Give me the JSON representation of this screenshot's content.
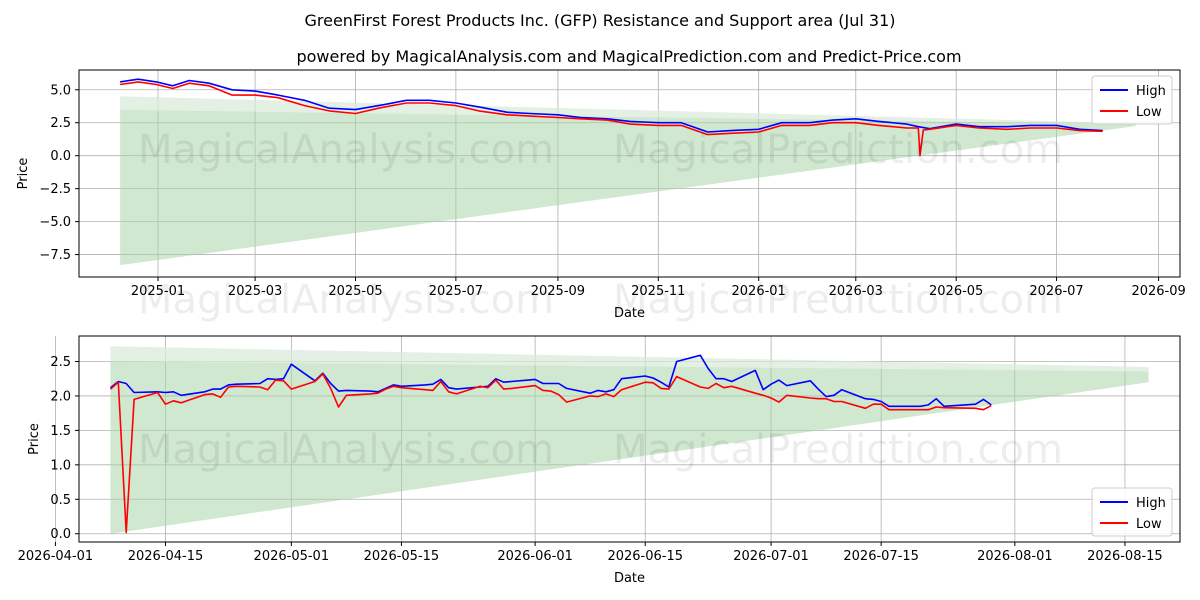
{
  "title": "GreenFirst Forest Products Inc. (GFP) Resistance and Support area (Jul 31)",
  "subtitle": "powered by MagicalAnalysis.com and MagicalPrediction.com and Predict-Price.com",
  "watermark_left": "MagicalAnalysis.com",
  "watermark_right": "MagicalPrediction.com",
  "colors": {
    "high": "#0000ff",
    "low": "#ff0000",
    "band": "#a9d4a9"
  },
  "chart_data": [
    {
      "type": "line",
      "xlabel": "Date",
      "ylabel": "Price",
      "x_ticks": [
        "2025-01",
        "2025-03",
        "2025-05",
        "2025-07",
        "2025-09",
        "2025-11",
        "2026-01",
        "2026-03",
        "2026-05",
        "2026-07",
        "2026-09"
      ],
      "y_ticks": [
        "−7.5",
        "−5.0",
        "−2.5",
        "0.0",
        "2.5",
        "5.0"
      ],
      "legend": {
        "position": "top-right",
        "entries": [
          "High",
          "Low"
        ]
      },
      "grid": true,
      "xlim": [
        "2024-11-14",
        "2026-09-14"
      ],
      "ylim": [
        -9.2,
        6.5
      ],
      "band": {
        "x": [
          "2024-12-09",
          "2026-08-18"
        ],
        "upper_start": 4.5,
        "lower_start": -8.3,
        "upper_end": 2.45,
        "lower_end": 2.25
      },
      "series": [
        {
          "name": "High",
          "x": [
            "2024-12-09",
            "2024-12-20",
            "2024-12-31",
            "2025-01-10",
            "2025-01-20",
            "2025-02-01",
            "2025-02-15",
            "2025-03-01",
            "2025-03-15",
            "2025-03-31",
            "2025-04-15",
            "2025-05-01",
            "2025-05-15",
            "2025-06-01",
            "2025-06-15",
            "2025-07-01",
            "2025-07-15",
            "2025-08-01",
            "2025-08-15",
            "2025-09-01",
            "2025-09-15",
            "2025-10-01",
            "2025-10-15",
            "2025-11-01",
            "2025-11-15",
            "2025-12-01",
            "2025-12-15",
            "2026-01-01",
            "2026-01-15",
            "2026-02-01",
            "2026-02-15",
            "2026-03-01",
            "2026-03-15",
            "2026-04-01",
            "2026-04-08",
            "2026-04-15",
            "2026-05-01",
            "2026-05-15",
            "2026-06-01",
            "2026-06-15",
            "2026-07-01",
            "2026-07-15",
            "2026-07-29"
          ],
          "values": [
            5.6,
            5.8,
            5.6,
            5.3,
            5.7,
            5.5,
            5.0,
            4.9,
            4.6,
            4.2,
            3.6,
            3.5,
            3.8,
            4.2,
            4.2,
            4.0,
            3.7,
            3.3,
            3.2,
            3.1,
            2.9,
            2.8,
            2.6,
            2.5,
            2.5,
            1.8,
            1.9,
            2.0,
            2.5,
            2.5,
            2.7,
            2.8,
            2.6,
            2.4,
            2.2,
            2.05,
            2.4,
            2.2,
            2.2,
            2.3,
            2.3,
            2.0,
            1.9
          ]
        },
        {
          "name": "Low",
          "x": [
            "2024-12-09",
            "2024-12-20",
            "2024-12-31",
            "2025-01-10",
            "2025-01-20",
            "2025-02-01",
            "2025-02-15",
            "2025-03-01",
            "2025-03-15",
            "2025-03-31",
            "2025-04-15",
            "2025-05-01",
            "2025-05-15",
            "2025-06-01",
            "2025-06-15",
            "2025-07-01",
            "2025-07-15",
            "2025-08-01",
            "2025-08-15",
            "2025-09-01",
            "2025-09-15",
            "2025-10-01",
            "2025-10-15",
            "2025-11-01",
            "2025-11-15",
            "2025-12-01",
            "2025-12-15",
            "2026-01-01",
            "2026-01-15",
            "2026-02-01",
            "2026-02-15",
            "2026-03-01",
            "2026-03-15",
            "2026-04-01",
            "2026-04-08",
            "2026-04-09",
            "2026-04-11",
            "2026-04-15",
            "2026-05-01",
            "2026-05-15",
            "2026-06-01",
            "2026-06-15",
            "2026-07-01",
            "2026-07-15",
            "2026-07-29"
          ],
          "values": [
            5.4,
            5.6,
            5.4,
            5.1,
            5.5,
            5.3,
            4.6,
            4.6,
            4.4,
            3.8,
            3.4,
            3.2,
            3.6,
            4.0,
            4.0,
            3.8,
            3.4,
            3.1,
            3.0,
            2.9,
            2.8,
            2.7,
            2.4,
            2.3,
            2.3,
            1.6,
            1.7,
            1.8,
            2.3,
            2.3,
            2.5,
            2.5,
            2.3,
            2.1,
            2.1,
            0.02,
            1.95,
            2.0,
            2.3,
            2.1,
            2.0,
            2.1,
            2.1,
            1.9,
            1.85
          ]
        }
      ]
    },
    {
      "type": "line",
      "xlabel": "Date",
      "ylabel": "Price",
      "x_ticks": [
        "2026-04-01",
        "2026-04-15",
        "2026-05-01",
        "2026-05-15",
        "2026-06-01",
        "2026-06-15",
        "2026-07-01",
        "2026-07-15",
        "2026-08-01",
        "2026-08-15"
      ],
      "y_ticks": [
        "0.0",
        "0.5",
        "1.0",
        "1.5",
        "2.0",
        "2.5"
      ],
      "legend": {
        "position": "bottom-right",
        "entries": [
          "High",
          "Low"
        ]
      },
      "grid": true,
      "xlim": [
        "2026-04-04",
        "2026-08-22"
      ],
      "ylim": [
        -0.12,
        2.87
      ],
      "band": {
        "x": [
          "2026-04-08",
          "2026-08-18"
        ],
        "upper_start": 2.72,
        "lower_start": 0.0,
        "upper_end": 2.42,
        "lower_end": 2.2
      },
      "series": [
        {
          "name": "High",
          "x": [
            "2026-04-08",
            "2026-04-09",
            "2026-04-10",
            "2026-04-11",
            "2026-04-14",
            "2026-04-15",
            "2026-04-16",
            "2026-04-17",
            "2026-04-20",
            "2026-04-21",
            "2026-04-22",
            "2026-04-23",
            "2026-04-24",
            "2026-04-27",
            "2026-04-28",
            "2026-04-29",
            "2026-04-30",
            "2026-05-01",
            "2026-05-04",
            "2026-05-05",
            "2026-05-06",
            "2026-05-07",
            "2026-05-08",
            "2026-05-11",
            "2026-05-12",
            "2026-05-13",
            "2026-05-14",
            "2026-05-15",
            "2026-05-18",
            "2026-05-19",
            "2026-05-20",
            "2026-05-21",
            "2026-05-22",
            "2026-05-25",
            "2026-05-26",
            "2026-05-27",
            "2026-05-28",
            "2026-05-29",
            "2026-06-01",
            "2026-06-02",
            "2026-06-03",
            "2026-06-04",
            "2026-06-05",
            "2026-06-08",
            "2026-06-09",
            "2026-06-10",
            "2026-06-11",
            "2026-06-12",
            "2026-06-15",
            "2026-06-16",
            "2026-06-17",
            "2026-06-18",
            "2026-06-19",
            "2026-06-22",
            "2026-06-23",
            "2026-06-24",
            "2026-06-25",
            "2026-06-26",
            "2026-06-29",
            "2026-06-30",
            "2026-07-01",
            "2026-07-02",
            "2026-07-03",
            "2026-07-06",
            "2026-07-07",
            "2026-07-08",
            "2026-07-09",
            "2026-07-10",
            "2026-07-13",
            "2026-07-14",
            "2026-07-15",
            "2026-07-16",
            "2026-07-20",
            "2026-07-21",
            "2026-07-22",
            "2026-07-23",
            "2026-07-27",
            "2026-07-28",
            "2026-07-29"
          ],
          "values": [
            2.12,
            2.21,
            2.18,
            2.05,
            2.06,
            2.05,
            2.06,
            2.01,
            2.06,
            2.1,
            2.1,
            2.16,
            2.17,
            2.18,
            2.25,
            2.24,
            2.25,
            2.46,
            2.22,
            2.33,
            2.18,
            2.07,
            2.08,
            2.07,
            2.06,
            2.11,
            2.16,
            2.14,
            2.16,
            2.17,
            2.24,
            2.12,
            2.1,
            2.13,
            2.14,
            2.25,
            2.2,
            2.21,
            2.24,
            2.18,
            2.18,
            2.18,
            2.11,
            2.04,
            2.08,
            2.06,
            2.09,
            2.25,
            2.29,
            2.26,
            2.2,
            2.13,
            2.5,
            2.59,
            2.4,
            2.25,
            2.25,
            2.21,
            2.37,
            2.09,
            2.17,
            2.23,
            2.15,
            2.22,
            2.1,
            1.99,
            2.01,
            2.09,
            1.96,
            1.95,
            1.92,
            1.85,
            1.85,
            1.87,
            1.96,
            1.85,
            1.88,
            1.95,
            1.87
          ]
        },
        {
          "name": "Low",
          "x": [
            "2026-04-08",
            "2026-04-09",
            "2026-04-10",
            "2026-04-11",
            "2026-04-14",
            "2026-04-15",
            "2026-04-16",
            "2026-04-17",
            "2026-04-20",
            "2026-04-21",
            "2026-04-22",
            "2026-04-23",
            "2026-04-24",
            "2026-04-27",
            "2026-04-28",
            "2026-04-29",
            "2026-04-30",
            "2026-05-01",
            "2026-05-04",
            "2026-05-05",
            "2026-05-06",
            "2026-05-07",
            "2026-05-08",
            "2026-05-11",
            "2026-05-12",
            "2026-05-13",
            "2026-05-14",
            "2026-05-15",
            "2026-05-18",
            "2026-05-19",
            "2026-05-20",
            "2026-05-21",
            "2026-05-22",
            "2026-05-25",
            "2026-05-26",
            "2026-05-27",
            "2026-05-28",
            "2026-05-29",
            "2026-06-01",
            "2026-06-02",
            "2026-06-03",
            "2026-06-04",
            "2026-06-05",
            "2026-06-08",
            "2026-06-09",
            "2026-06-10",
            "2026-06-11",
            "2026-06-12",
            "2026-06-15",
            "2026-06-16",
            "2026-06-17",
            "2026-06-18",
            "2026-06-19",
            "2026-06-22",
            "2026-06-23",
            "2026-06-24",
            "2026-06-25",
            "2026-06-26",
            "2026-06-29",
            "2026-06-30",
            "2026-07-01",
            "2026-07-02",
            "2026-07-03",
            "2026-07-06",
            "2026-07-07",
            "2026-07-08",
            "2026-07-09",
            "2026-07-10",
            "2026-07-13",
            "2026-07-14",
            "2026-07-15",
            "2026-07-16",
            "2026-07-20",
            "2026-07-21",
            "2026-07-22",
            "2026-07-23",
            "2026-07-27",
            "2026-07-28",
            "2026-07-29"
          ],
          "values": [
            2.1,
            2.2,
            0.02,
            1.95,
            2.05,
            1.88,
            1.93,
            1.9,
            2.02,
            2.03,
            1.98,
            2.13,
            2.14,
            2.13,
            2.09,
            2.23,
            2.22,
            2.1,
            2.21,
            2.32,
            2.11,
            1.84,
            2.01,
            2.03,
            2.04,
            2.1,
            2.14,
            2.12,
            2.09,
            2.08,
            2.21,
            2.06,
            2.03,
            2.14,
            2.12,
            2.23,
            2.1,
            2.11,
            2.15,
            2.08,
            2.07,
            2.02,
            1.91,
            2.0,
            1.99,
            2.03,
            1.99,
            2.09,
            2.2,
            2.19,
            2.11,
            2.1,
            2.28,
            2.13,
            2.11,
            2.18,
            2.12,
            2.14,
            2.04,
            2.01,
            1.97,
            1.91,
            2.01,
            1.97,
            1.96,
            1.96,
            1.92,
            1.92,
            1.82,
            1.88,
            1.88,
            1.8,
            1.8,
            1.8,
            1.84,
            1.83,
            1.82,
            1.8,
            1.86
          ]
        }
      ]
    }
  ]
}
